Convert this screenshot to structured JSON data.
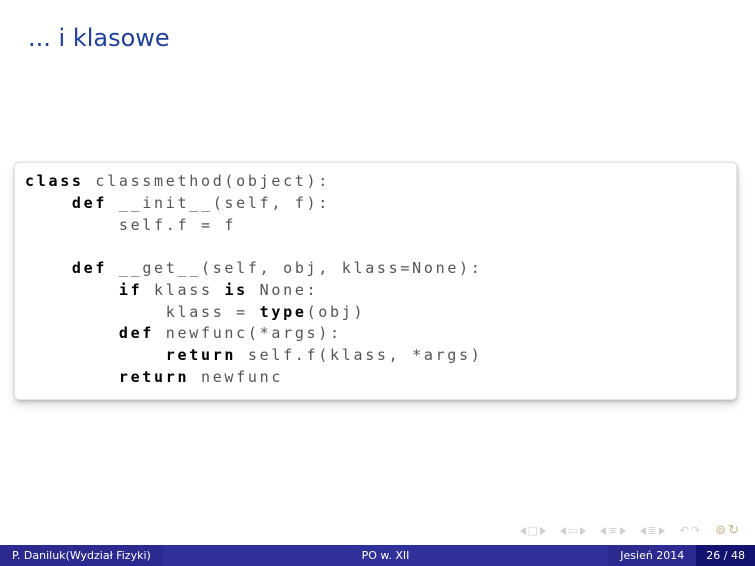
{
  "title": "... i klasowe",
  "code": {
    "l1a": "class",
    "l1b": " classmethod(object):",
    "l2a": "    def",
    "l2b": " __init__(self, f):",
    "l3": "        self.f = f",
    "l4": "",
    "l5a": "    def",
    "l5b": " __get__(self, obj, klass=None):",
    "l6a": "        if",
    "l6b": " klass ",
    "l6c": "is",
    "l6d": " None:",
    "l7a": "            klass = ",
    "l7b": "type",
    "l7c": "(obj)",
    "l8a": "        def",
    "l8b": " newfunc(*args):",
    "l9a": "            return",
    "l9b": " self.f(klass, *args)",
    "l10a": "        return",
    "l10b": " newfunc"
  },
  "footer": {
    "author": "P. Daniluk(Wydział Fizyki)",
    "center": "PO w. XII",
    "date": "Jesień 2014",
    "page": "26 / 48"
  }
}
